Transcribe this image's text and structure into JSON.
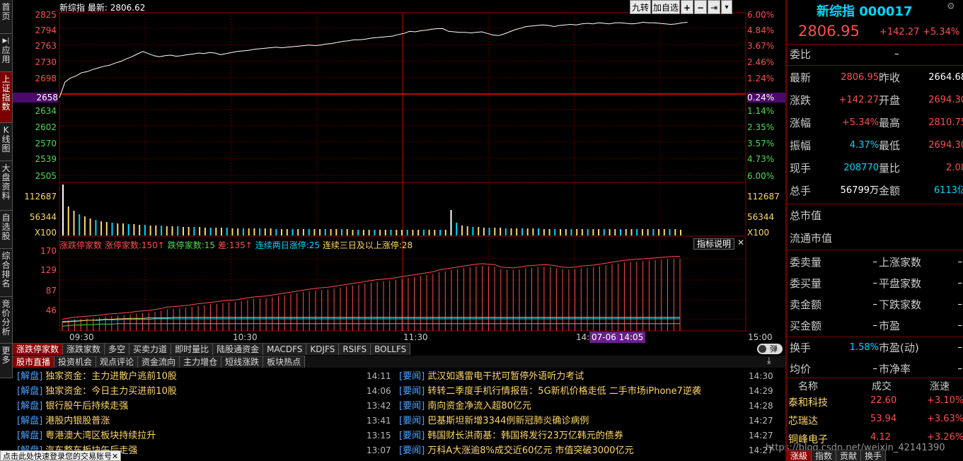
{
  "nav": [
    "首页",
    "应用",
    "上证指数",
    "K线图",
    "大盘资料",
    "自选股",
    "综合排名",
    "竞价分析",
    "更多"
  ],
  "chart": {
    "title": "新综指",
    "latest_label": "最新:",
    "latest_value": "2806.62",
    "price_labels": [
      "2825",
      "2794",
      "2763",
      "2730",
      "2698",
      "2658",
      "2634",
      "2602",
      "2570",
      "2539",
      "2505"
    ],
    "pct_labels": [
      "6.00%",
      "4.84%",
      "3.67%",
      "2.46%",
      "1.24%",
      "0.24%",
      "1.14%",
      "2.35%",
      "3.57%",
      "4.73%",
      "6.00%"
    ],
    "vol_labels": [
      "112687",
      "56344",
      "X100"
    ],
    "vol_right_labels": [
      "112687",
      "56344",
      "X100"
    ],
    "time_labels": [
      "09:30",
      "10:30",
      "11:30",
      "14:",
      "15:00"
    ],
    "cursor_time": "07-06 14:05",
    "toolbar": {
      "jiuzhuan": "九转",
      "add_watch": "加自选",
      "plus": "+",
      "minus": "−",
      "arrow": "⇥",
      "dropdown": "▾"
    }
  },
  "indicator": {
    "name": "涨跌停家数",
    "up_label": "涨停家数:",
    "up_value": "150",
    "down_label": "跌停家数:",
    "down_value": "15",
    "diff_label": "差:",
    "diff_value": "135",
    "cont2_label": "连续两日涨停:",
    "cont2_value": "25",
    "cont3_label": "连续三日及以上涨停:",
    "cont3_value": "28",
    "explain": "指标说明",
    "close": "✕",
    "y_labels": [
      "170",
      "129",
      "87",
      "46"
    ]
  },
  "indicator_tabs": [
    "涨跌停家数",
    "涨跌家数",
    "多空",
    "买卖力道",
    "即时量比",
    "陆股通资金",
    "MACDFS",
    "KDJFS",
    "RSIFS",
    "BOLLFS"
  ],
  "toggle_label": "弹",
  "news_tabs": [
    "股市直播",
    "投资机会",
    "观点评论",
    "资金流向",
    "主力增仓",
    "短线涨跌",
    "板块热点"
  ],
  "news_left": [
    {
      "cat": "[解盘]",
      "title": "独家资金：主力进散户逃前10股",
      "time": "14:11"
    },
    {
      "cat": "[解盘]",
      "title": "独家资金：今日主力买进前10股",
      "time": "14:06"
    },
    {
      "cat": "[解盘]",
      "title": "银行股午后持续走强",
      "time": "13:42"
    },
    {
      "cat": "[解盘]",
      "title": "港股内银股普涨",
      "time": "13:41"
    },
    {
      "cat": "[解盘]",
      "title": "粤港澳大湾区板块持续拉升",
      "time": "13:15"
    },
    {
      "cat": "[解盘]",
      "title": "汽车整车板块午后走强",
      "time": "13:07"
    }
  ],
  "news_right": [
    {
      "cat": "[要闻]",
      "title": "武汉如遇雷电干扰可暂停外语听力考试",
      "time": "14:30"
    },
    {
      "cat": "[要闻]",
      "title": "转转二季度手机行情报告：5G新机价格走低 二手市场iPhone7逆袭",
      "time": "14:29"
    },
    {
      "cat": "[要闻]",
      "title": "南向资金净流入超80亿元",
      "time": "14:28"
    },
    {
      "cat": "[要闻]",
      "title": "巴基斯坦新增3344例新冠肺炎确诊病例",
      "time": "14:27"
    },
    {
      "cat": "[要闻]",
      "title": "韩国财长洪南基：韩国将发行23万亿韩元的债券",
      "time": "14:27"
    },
    {
      "cat": "[要闻]",
      "title": "万科A大涨逾8%成交近60亿元 市值突破3000亿元",
      "time": "14:27"
    }
  ],
  "login_tip": "点击此处快速登录您的交易账号",
  "login_close": "✕",
  "watermark": "https://blog.csdn.net/weixin_42141390",
  "quote": {
    "name": "新综指",
    "code": "000017",
    "price": "2806.95",
    "change": "+142.27",
    "pct": "+5.34%",
    "weibi_label": "委比",
    "weibi_value": "–",
    "rows": [
      {
        "l1": "最新",
        "v1": "2806.95",
        "c1": "red",
        "l2": "昨收",
        "v2": "2664.68",
        "c2": "white"
      },
      {
        "l1": "涨跌",
        "v1": "+142.27",
        "c1": "red",
        "l2": "开盘",
        "v2": "2694.30",
        "c2": "red"
      },
      {
        "l1": "涨幅",
        "v1": "+5.34%",
        "c1": "red",
        "l2": "最高",
        "v2": "2810.75",
        "c2": "red"
      },
      {
        "l1": "振幅",
        "v1": "4.37%",
        "c1": "cyan",
        "l2": "最低",
        "v2": "2694.30",
        "c2": "red"
      },
      {
        "l1": "现手",
        "v1": "208770",
        "c1": "cyan",
        "l2": "量比",
        "v2": "2.08",
        "c2": "red"
      },
      {
        "l1": "总手",
        "v1": "56799万",
        "c1": "white",
        "l2": "金额",
        "v2": "6113亿",
        "c2": "cyan"
      }
    ],
    "mkt_value_label": "总市值",
    "float_value_label": "流通市值",
    "rows2": [
      {
        "l1": "委卖量",
        "v1": "–",
        "l2": "上涨家数",
        "v2": "–"
      },
      {
        "l1": "委买量",
        "v1": "–",
        "l2": "平盘家数",
        "v2": "–"
      },
      {
        "l1": "卖金额",
        "v1": "–",
        "l2": "下跌家数",
        "v2": "–"
      },
      {
        "l1": "买金额",
        "v1": "–",
        "l2": "市盈",
        "v2": "–"
      }
    ],
    "huanshou_label": "换手",
    "huanshou_value": "1.58%",
    "pe_dyn_label": "市盈(动)",
    "pe_dyn_value": "–",
    "junjia_label": "均价",
    "junjia_value": "–",
    "pb_label": "市净率",
    "pb_value": "–",
    "list_headers": [
      "名称",
      "成交",
      "涨速"
    ],
    "list": [
      {
        "name": "泰和科技",
        "price": "22.60",
        "speed": "+3.10%"
      },
      {
        "name": "芯瑞达",
        "price": "53.94",
        "speed": "+3.63%"
      },
      {
        "name": "铜峰电子",
        "price": "4.12",
        "speed": "+3.26%"
      }
    ],
    "bottom_tabs": [
      "涨級",
      "指数",
      "贡献",
      "换手"
    ]
  },
  "chart_data": {
    "type": "line",
    "price_series": [
      2664.68,
      2694.3,
      2702,
      2706,
      2712,
      2714,
      2718,
      2721,
      2724,
      2726,
      2730,
      2733,
      2738,
      2742,
      2747,
      2752,
      2748,
      2744,
      2742,
      2744,
      2745,
      2743,
      2744,
      2746,
      2747,
      2749,
      2748,
      2750,
      2749,
      2746,
      2748,
      2750,
      2752,
      2753,
      2754,
      2756,
      2757,
      2758,
      2759,
      2760,
      2759,
      2760,
      2761,
      2762,
      2763,
      2764,
      2763,
      2764,
      2766,
      2767,
      2769,
      2771,
      2772,
      2774,
      2774,
      2775,
      2777,
      2778,
      2779,
      2780,
      2781,
      2784,
      2786,
      2790,
      2789,
      2791,
      2792,
      2794,
      2795,
      2795,
      2790,
      2789,
      2788,
      2788,
      2787,
      2788,
      2789,
      2786,
      2783,
      2782,
      2785,
      2789,
      2793,
      2796,
      2799,
      2800,
      2801,
      2802,
      2801,
      2799,
      2801,
      2802,
      2803,
      2802,
      2804,
      2805,
      2804,
      2806,
      2805,
      2804,
      2806,
      2806,
      2805,
      2804,
      2805,
      2807,
      2806,
      2806,
      2805,
      2804,
      2803,
      2804,
      2806,
      2806.95
    ],
    "volume_series": [
      72,
      41,
      35,
      30,
      27,
      24,
      22,
      20,
      19,
      18,
      17,
      17,
      16,
      16,
      15,
      15,
      14,
      14,
      14,
      13,
      13,
      13,
      12,
      12,
      12,
      12,
      11,
      11,
      11,
      11,
      11,
      10,
      10,
      10,
      10,
      10,
      10,
      10,
      10,
      9,
      9,
      9,
      9,
      9,
      9,
      9,
      9,
      9,
      9,
      9,
      9,
      9,
      9,
      8,
      8,
      8,
      8,
      8,
      8,
      8,
      8,
      8,
      8,
      8,
      8,
      8,
      8,
      8,
      8,
      8,
      8,
      36,
      18,
      14,
      13,
      12,
      12,
      11,
      11,
      11,
      11,
      10,
      10,
      10,
      10,
      10,
      10,
      10,
      9,
      9,
      9,
      9,
      9,
      9,
      9,
      9,
      9,
      9,
      9,
      9,
      9,
      9,
      9,
      9,
      9,
      9,
      9,
      9,
      9,
      9,
      9,
      9,
      9,
      8
    ],
    "up_limit_series": [
      20,
      22,
      24,
      25,
      26,
      27,
      28,
      30,
      31,
      32,
      33,
      34,
      36,
      37,
      38,
      40,
      42,
      45,
      46,
      47,
      48,
      50,
      52,
      53,
      55,
      56,
      58,
      59,
      60,
      62,
      64,
      66,
      67,
      68,
      70,
      72,
      74,
      76,
      78,
      80,
      82,
      84,
      85,
      86,
      88,
      90,
      92,
      94,
      96,
      98,
      100,
      102,
      103,
      104,
      106,
      108,
      110,
      112,
      114,
      116,
      118,
      122,
      124,
      126,
      128,
      130,
      132,
      134,
      135,
      134,
      133,
      128,
      127,
      126,
      128,
      130,
      131,
      132,
      133,
      132,
      130,
      128,
      127,
      128,
      130,
      131,
      132,
      134,
      136,
      138,
      140,
      142,
      143,
      144,
      145,
      146,
      147,
      148,
      149,
      150,
      150
    ],
    "down_limit_series": [
      10,
      11,
      12,
      12,
      13,
      13,
      14,
      14,
      14,
      15,
      15,
      15,
      15,
      15,
      15,
      15,
      15,
      15,
      15,
      15,
      15,
      15,
      15,
      15,
      15,
      15,
      15,
      15,
      15,
      15,
      15,
      15,
      15,
      15,
      15,
      15,
      15,
      15,
      15,
      15,
      15,
      15,
      15,
      15,
      15,
      15,
      15,
      15,
      15,
      15,
      15,
      15,
      15,
      15,
      15,
      15,
      15,
      15,
      15,
      15,
      15,
      15,
      15,
      15,
      15,
      15,
      15,
      15,
      15,
      15,
      15,
      15,
      15,
      15,
      15,
      15,
      15,
      15,
      15,
      15,
      15,
      15,
      15,
      15,
      15,
      15,
      15,
      15,
      15,
      15,
      15,
      15,
      15,
      15,
      15,
      15,
      15,
      15,
      15,
      15,
      15
    ],
    "cont2_series": [
      20,
      20,
      21,
      21,
      22,
      22,
      22,
      23,
      23,
      23,
      24,
      24,
      24,
      24,
      24,
      25,
      25,
      25,
      25,
      25,
      25,
      25,
      25,
      25,
      25,
      25,
      25,
      25,
      25,
      25,
      25,
      25,
      25,
      25,
      25,
      25,
      25,
      25,
      25,
      25,
      25,
      25,
      25,
      25,
      25,
      25,
      25,
      25,
      25,
      25,
      25,
      25,
      25,
      25,
      25,
      25,
      25,
      25,
      25,
      25,
      25,
      25,
      25,
      25,
      25,
      25,
      25,
      25,
      25,
      25,
      25,
      25,
      25,
      25,
      25,
      25,
      25,
      25,
      25,
      25,
      25,
      25,
      25,
      25,
      25,
      25,
      25,
      25,
      25,
      25,
      25,
      25,
      25,
      25,
      25,
      25,
      25,
      25,
      25,
      25,
      25
    ],
    "cont3_series": [
      18,
      19,
      20,
      21,
      22,
      22,
      23,
      24,
      24,
      25,
      25,
      26,
      26,
      26,
      27,
      27,
      27,
      27,
      28,
      28,
      28,
      28,
      28,
      28,
      28,
      28,
      28,
      28,
      28,
      28,
      28,
      28,
      28,
      28,
      28,
      28,
      28,
      28,
      28,
      28,
      28,
      28,
      28,
      28,
      28,
      28,
      28,
      28,
      28,
      28,
      28,
      28,
      28,
      28,
      28,
      28,
      28,
      28,
      28,
      28,
      28,
      28,
      28,
      28,
      28,
      28,
      28,
      28,
      28,
      28,
      28,
      28,
      28,
      28,
      28,
      28,
      28,
      28,
      28,
      28,
      28,
      28,
      28,
      28,
      28,
      28,
      28,
      28,
      28,
      28,
      28,
      28,
      28,
      28,
      28,
      28,
      28,
      28,
      28,
      28,
      28
    ],
    "ylim_price": [
      2505,
      2825
    ],
    "ylim_indicator": [
      0,
      170
    ],
    "x_ticks": [
      "09:30",
      "10:30",
      "11:30",
      "14:",
      "15:00"
    ]
  }
}
